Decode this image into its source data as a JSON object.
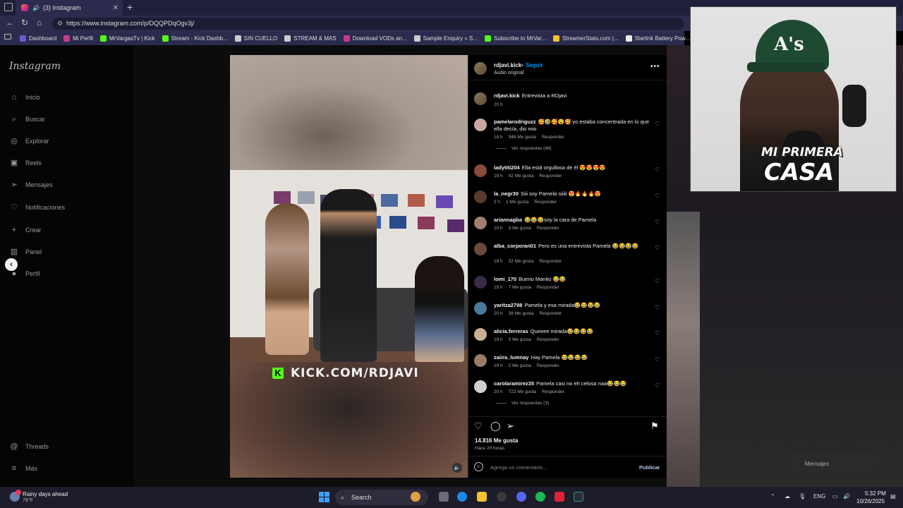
{
  "browser": {
    "tab_title": "(3) Instagram",
    "new_tab": "+",
    "tab_close": "✕",
    "url": "https://www.instagram.com/p/DQQPDqOgv3j/",
    "bookmarks": [
      "Dashboard",
      "Mi Perfil",
      "MrVargasTv | Kick",
      "Stream - Kick Dashb...",
      "SIN CUELLO",
      "STREAM & MAS",
      "Download VODs an...",
      "Sample Enquiry » S...",
      "Subscribe to MrVar...",
      "StreamerStats.com |...",
      "Starlink Battery Pow..."
    ]
  },
  "sidebar": {
    "logo": "Instagram",
    "items": [
      {
        "label": "Inicio",
        "icon": "⌂"
      },
      {
        "label": "Buscar",
        "icon": "⌕"
      },
      {
        "label": "Explorar",
        "icon": "◎"
      },
      {
        "label": "Reels",
        "icon": "▣"
      },
      {
        "label": "Mensajes",
        "icon": "➢"
      },
      {
        "label": "Notificaciones",
        "icon": "♡"
      },
      {
        "label": "Crear",
        "icon": "+"
      },
      {
        "label": "Panel",
        "icon": "▥"
      },
      {
        "label": "Perfil",
        "icon": "●"
      }
    ],
    "bottom": [
      {
        "label": "Threads",
        "icon": "@"
      },
      {
        "label": "Más",
        "icon": "≡"
      }
    ]
  },
  "video": {
    "overlay_text": "KICK.COM/RDJAVI",
    "kick_letter": "K",
    "mute_icon": "🔈"
  },
  "post": {
    "username": "rdjavi.kick",
    "follow": "Seguir",
    "dot": "•",
    "audio": "Audio original",
    "caption_user": "rdjavi.kick",
    "caption": "Entrevista a RDjavi",
    "caption_time": "20 h",
    "comments": [
      {
        "user": "pamelarodriguzz",
        "text": "🥰🤣🥰😮🥰 yo estaba concentrada en lo que ella decía, dio mio",
        "time": "18 h",
        "likes": "946 Me gusta",
        "reply": "Responder",
        "replies": "Ver respuestas (48)"
      },
      {
        "user": "ladytiti204",
        "text": "Ella está orgullosa de él 😍😍😍😍",
        "time": "19 h",
        "likes": "42 Me gusta",
        "reply": "Responder"
      },
      {
        "user": "la_negr30",
        "text": "Siii soy Pamela siiiii 😍🔥🔥🔥😍",
        "time": "2 h",
        "likes": "1 Me gusta",
        "reply": "Responder"
      },
      {
        "user": "ariannagba",
        "text": "😂😂😂soy la cara de Pamela",
        "time": "10 h",
        "likes": "3 Me gusta",
        "reply": "Responder"
      },
      {
        "user": "alba_corporan01",
        "text": "Pero es una entrevista Pamela 😂😂😂😂",
        "time": "19 h",
        "likes": "32 Me gusta",
        "reply": "Responder"
      },
      {
        "user": "lomi_170",
        "text": "Bueno Manito 😂😂",
        "time": "19 h",
        "likes": "7 Me gusta",
        "reply": "Responder"
      },
      {
        "user": "yaritza2798",
        "text": "Pamela y esa mirada😂😂😂😂",
        "time": "20 h",
        "likes": "38 Me gusta",
        "reply": "Responder"
      },
      {
        "user": "alicia.ferreras",
        "text": "Queeee mirada😂😂😂😂",
        "time": "19 h",
        "likes": "3 Me gusta",
        "reply": "Responder"
      },
      {
        "user": "zaiira_lumnay",
        "text": "Hay Pamela 😂😂😂😂",
        "time": "19 h",
        "likes": "2 Me gusta",
        "reply": "Responder"
      },
      {
        "user": "carolaramirez35",
        "text": "Pamela casi no eh celosa naa😂😂😂",
        "time": "20 h",
        "likes": "722 Me gusta",
        "reply": "Responder",
        "replies": "Ver respuestas (3)"
      }
    ],
    "likes_total": "14.816 Me gusta",
    "posted": "Hace 20 horas",
    "comment_placeholder": "Agrega un comentario...",
    "publish": "Publicar"
  },
  "overlay": {
    "stream_title_line1": "MI PRIMERA",
    "stream_title_line2": "CASA",
    "cap_logo": "A's",
    "messages": "Mensajes"
  },
  "taskbar": {
    "weather_title": "Rainy days ahead",
    "weather_temp": "78°F",
    "search": "Search",
    "lang": "ENG",
    "time": "5:32 PM",
    "date": "10/26/2025"
  },
  "colors": {
    "accent": "#0095f6",
    "kick_green": "#53fc18",
    "chrome_bg": "#2b2b4d"
  }
}
